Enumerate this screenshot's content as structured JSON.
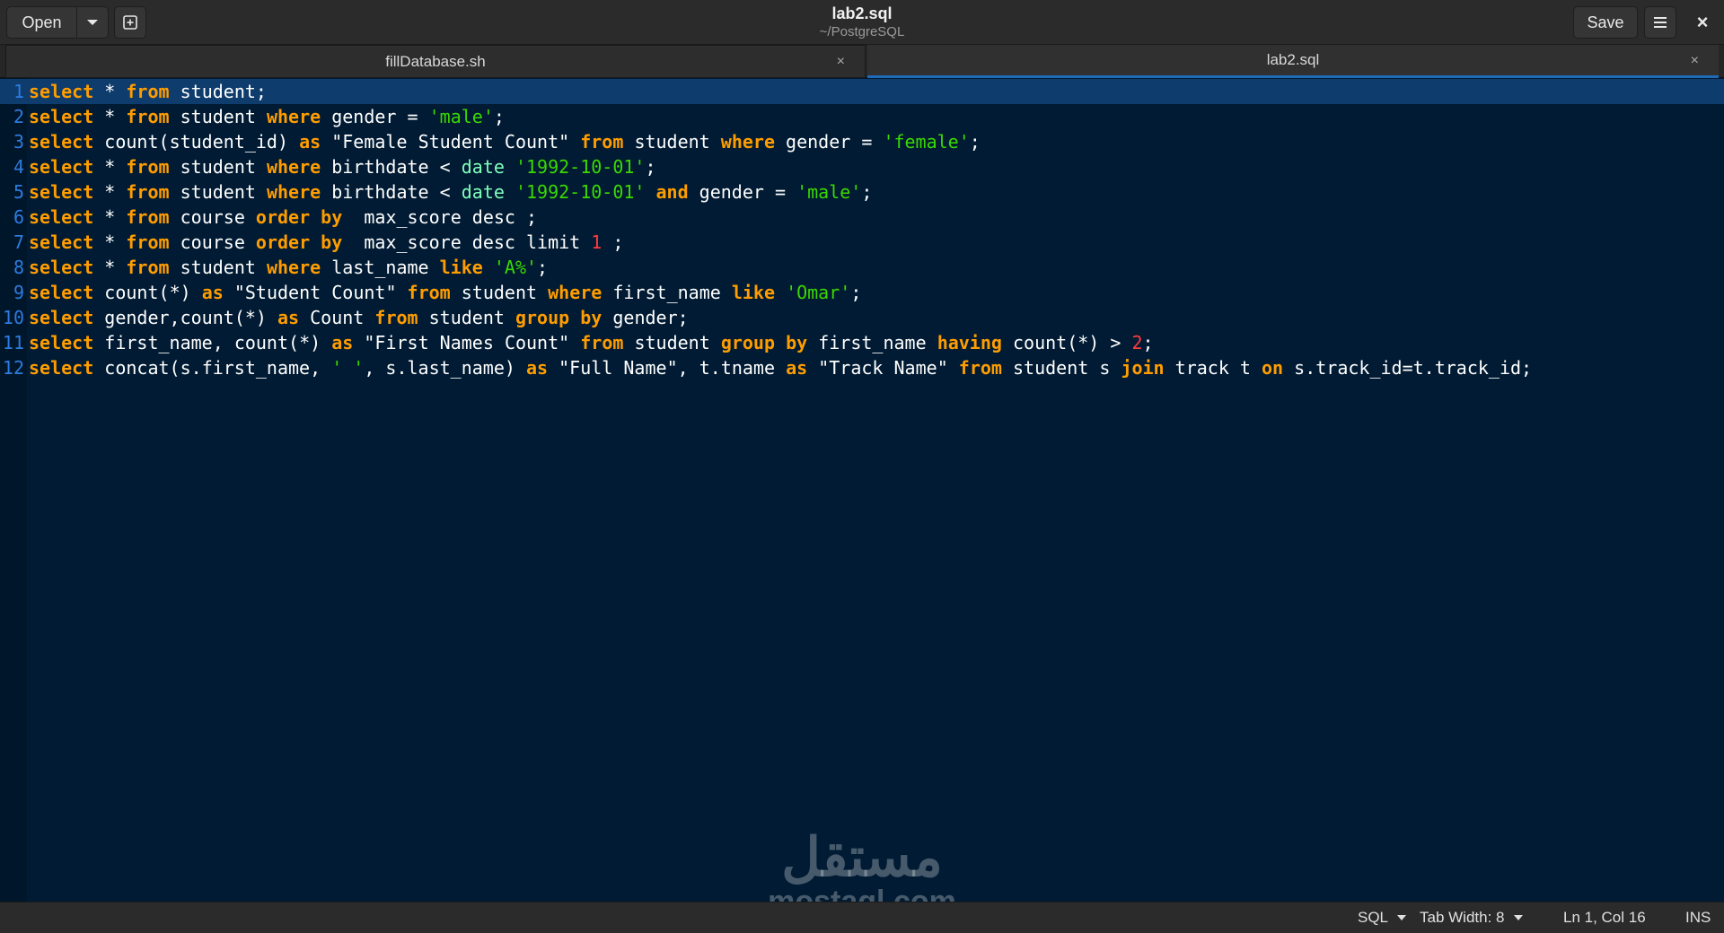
{
  "header": {
    "open_label": "Open",
    "title": "lab2.sql",
    "subtitle": "~/PostgreSQL",
    "save_label": "Save",
    "close_glyph": "×"
  },
  "tabs": [
    {
      "label": "fillDatabase.sh",
      "close": "×",
      "active": false
    },
    {
      "label": "lab2.sql",
      "close": "×",
      "active": true
    }
  ],
  "editor": {
    "lines": [
      {
        "num": "1",
        "text": "select * from student;"
      },
      {
        "num": "2",
        "text": "select * from student where gender = 'male';"
      },
      {
        "num": "3",
        "text": "select count(student_id) as \"Female Student Count\" from student where gender = 'female';"
      },
      {
        "num": "4",
        "text": "select * from student where birthdate < date '1992-10-01';"
      },
      {
        "num": "5",
        "text": "select * from student where birthdate < date '1992-10-01' and gender = 'male';"
      },
      {
        "num": "6",
        "text": "select * from course order by  max_score desc ;"
      },
      {
        "num": "7",
        "text": "select * from course order by  max_score desc limit 1 ;"
      },
      {
        "num": "8",
        "text": "select * from student where last_name like 'A%';"
      },
      {
        "num": "9",
        "text": "select count(*) as \"Student Count\" from student where first_name like 'Omar';"
      },
      {
        "num": "10",
        "text": "select gender,count(*) as Count from student group by gender;"
      },
      {
        "num": "11",
        "text": "select first_name, count(*) as \"First Names Count\" from student group by first_name having count(*) > 2;"
      },
      {
        "num": "12",
        "text": "select concat(s.first_name, ' ', s.last_name) as \"Full Name\", t.tname as \"Track Name\" from student s join track t on s.track_id=t.track_id;"
      }
    ]
  },
  "watermark": {
    "arabic": "مستقل",
    "latin": "mostaql.com"
  },
  "status": {
    "language": "SQL",
    "tab_width": "Tab Width: 8",
    "position": "Ln 1, Col 16",
    "mode": "INS"
  },
  "colors": {
    "background": "#001b33",
    "keyword": "#ff9d00",
    "string": "#3ad900",
    "number": "#ff3b3b",
    "line_number": "#2d7ce0",
    "current_line": "#0e3c6c",
    "tab_accent": "#1c6ab8"
  }
}
